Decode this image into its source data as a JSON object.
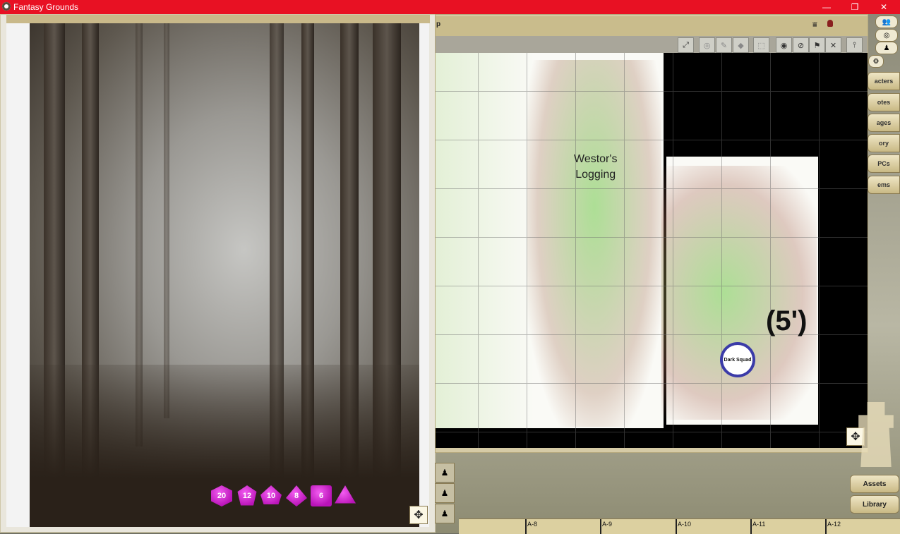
{
  "window": {
    "title": "Fantasy Grounds",
    "controls": [
      "—",
      "❐",
      "✕"
    ]
  },
  "image_window": {
    "dice": [
      "20",
      "12",
      "10",
      "8",
      "6",
      "4"
    ],
    "nav_icon": "move-icon"
  },
  "map_window": {
    "title_fragment": "p",
    "toolbar": [
      "zoom-fit-icon",
      "mask-icon",
      "paint-icon",
      "eraser-icon",
      "select-icon",
      "target-icon",
      "no-los-icon",
      "flag-icon",
      "swords-icon",
      "pin-icon"
    ],
    "labels": {
      "area": "Westor's\nLogging",
      "measure": "(5')",
      "token": "Dark Squad"
    },
    "nav_icon": "move-icon"
  },
  "sidebar": {
    "top_buttons": [
      "👥",
      "⚙"
    ],
    "tabs": [
      "acters",
      "otes",
      "ages",
      "ory",
      "PCs",
      "ems"
    ],
    "bottom": [
      "Assets",
      "Library"
    ]
  },
  "hotbar": [
    "A-8",
    "A-9",
    "A-10",
    "A-11",
    "A-12"
  ]
}
